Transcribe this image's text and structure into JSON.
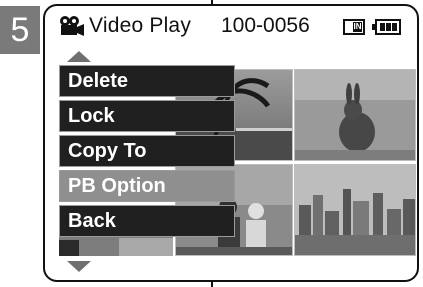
{
  "step_number": "5",
  "header": {
    "title": "Video Play",
    "file_number": "100-0056",
    "media_icon_label": "IN"
  },
  "menu": {
    "items": [
      {
        "label": "Delete",
        "selected": false
      },
      {
        "label": "Lock",
        "selected": false
      },
      {
        "label": "Copy To",
        "selected": false
      },
      {
        "label": "PB Option",
        "selected": true
      },
      {
        "label": "Back",
        "selected": false
      }
    ]
  },
  "thumbnails": [
    {
      "subject": "palm-beach"
    },
    {
      "subject": "rabbit"
    },
    {
      "subject": "people"
    },
    {
      "subject": "city-skyline"
    },
    {
      "subject": "partial-left"
    }
  ],
  "colors": {
    "menu_bg": "#202020",
    "menu_selected": "#8f8f8f",
    "step_box": "#7a7a7a",
    "arrow": "#6f6f6f"
  }
}
